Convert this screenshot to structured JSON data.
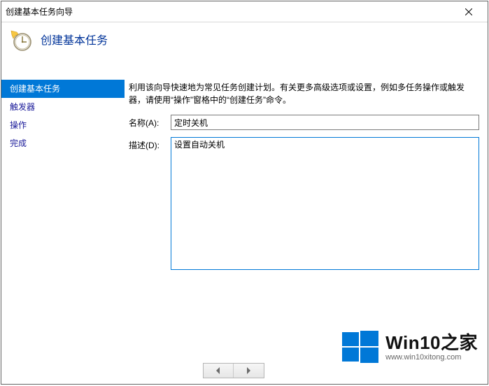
{
  "titlebar": {
    "title": "创建基本任务向导"
  },
  "header": {
    "heading": "创建基本任务"
  },
  "sidebar": {
    "steps": [
      {
        "label": "创建基本任务",
        "active": true
      },
      {
        "label": "触发器",
        "active": false
      },
      {
        "label": "操作",
        "active": false
      },
      {
        "label": "完成",
        "active": false
      }
    ]
  },
  "main": {
    "intro": "利用该向导快速地为常见任务创建计划。有关更多高级选项或设置，例如多任务操作或触发器，请使用“操作”窗格中的“创建任务”命令。",
    "name_label": "名称(A):",
    "name_value": "定时关机",
    "desc_label": "描述(D):",
    "desc_value": "设置自动关机"
  },
  "watermark": {
    "text": "Win10之家",
    "url": "www.win10xitong.com"
  }
}
